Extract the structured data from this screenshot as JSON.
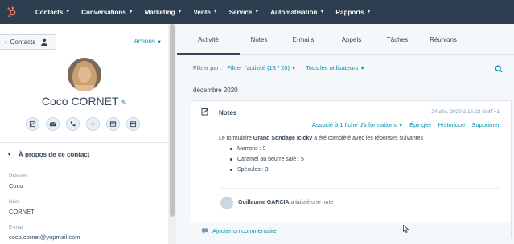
{
  "topnav": {
    "items": [
      {
        "label": "Contacts"
      },
      {
        "label": "Conversations"
      },
      {
        "label": "Marketing"
      },
      {
        "label": "Vente"
      },
      {
        "label": "Service"
      },
      {
        "label": "Automatisation"
      },
      {
        "label": "Rapports"
      }
    ],
    "logo_color": "#ff7a59"
  },
  "sidebar": {
    "back_label": "Contacts",
    "actions_label": "Actions",
    "contact_name": "Coco CORNET",
    "about_label": "À propos de ce contact",
    "fields": [
      {
        "label": "Prénom",
        "value": "Coco"
      },
      {
        "label": "Nom",
        "value": "CORNET"
      },
      {
        "label": "E-mail",
        "value": "coco.cornet@yopmail.com"
      }
    ]
  },
  "main": {
    "tabs": [
      "Activité",
      "Notes",
      "E-mails",
      "Appels",
      "Tâches",
      "Réunions"
    ],
    "filter_label": "Filtrer par :",
    "filter_activity": "Filtrer l'activité (18 / 20)",
    "filter_users": "Tous les utilisateurs",
    "month": "décembre 2020",
    "note": {
      "title": "Notes",
      "date": "24 déc. 2020 à 15:22 GMT+1",
      "associated": "Associé à 1 fiche d'informations",
      "pin": "Épingler",
      "history": "Historique",
      "delete": "Supprimer",
      "body_prefix": "Le formulaire ",
      "form_name": "Grand Sondage Icicky",
      "body_suffix": " a été complété avec les réponses suivantes",
      "answers": [
        "Marrons : 9",
        "Caramel au beurre salé : 5",
        "Spéculos : 3"
      ],
      "author": "Guillaume GARCIA",
      "author_action": " a laissé une note",
      "add_comment": "Ajouter un commentaire"
    }
  }
}
